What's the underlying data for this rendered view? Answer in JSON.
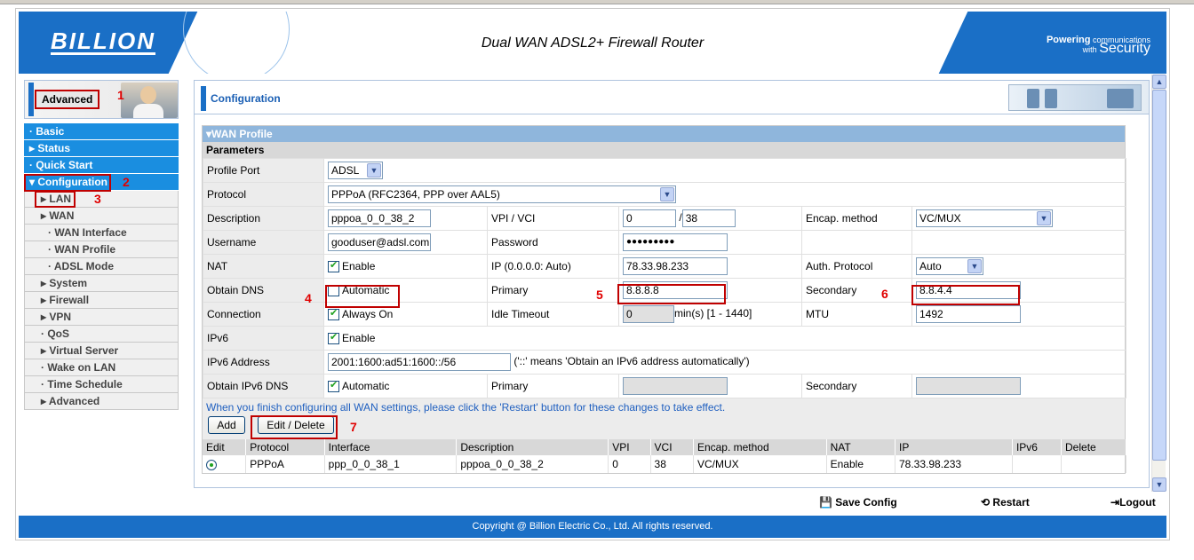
{
  "header": {
    "logo": "BILLION",
    "title": "Dual WAN ADSL2+ Firewall Router",
    "tag_line1": "Powering",
    "tag_line2": "communications",
    "tag_line3": "with",
    "tag_line4": "Security"
  },
  "sidebar": {
    "advanced_btn": "Advanced",
    "items": [
      {
        "label": "· Basic",
        "level": "top"
      },
      {
        "label": "▸ Status",
        "level": "top"
      },
      {
        "label": "· Quick Start",
        "level": "top"
      },
      {
        "label": "▾ Configuration",
        "level": "top"
      },
      {
        "label": "▸ LAN",
        "level": "sub"
      },
      {
        "label": "▸ WAN",
        "level": "sub"
      },
      {
        "label": "· WAN Interface",
        "level": "subsub"
      },
      {
        "label": "· WAN Profile",
        "level": "subsub"
      },
      {
        "label": "· ADSL Mode",
        "level": "subsub"
      },
      {
        "label": "▸ System",
        "level": "sub"
      },
      {
        "label": "▸ Firewall",
        "level": "sub"
      },
      {
        "label": "▸ VPN",
        "level": "sub"
      },
      {
        "label": "· QoS",
        "level": "sub"
      },
      {
        "label": "▸ Virtual Server",
        "level": "sub"
      },
      {
        "label": "· Wake on LAN",
        "level": "sub"
      },
      {
        "label": "· Time Schedule",
        "level": "sub"
      },
      {
        "label": "▸ Advanced",
        "level": "sub"
      }
    ]
  },
  "annotations": [
    "1",
    "2",
    "3",
    "4",
    "5",
    "6",
    "7"
  ],
  "main": {
    "title": "Configuration",
    "panel_title": "▾WAN Profile",
    "params_title": "Parameters",
    "labels": {
      "profile_port": "Profile Port",
      "protocol": "Protocol",
      "description": "Description",
      "vpi_vci": "VPI / VCI",
      "encap": "Encap. method",
      "username": "Username",
      "password": "Password",
      "nat": "NAT",
      "ip": "IP (0.0.0.0: Auto)",
      "auth": "Auth. Protocol",
      "obtain_dns": "Obtain DNS",
      "primary": "Primary",
      "secondary": "Secondary",
      "connection": "Connection",
      "idle": "Idle Timeout",
      "mtu": "MTU",
      "ipv6": "IPv6",
      "ipv6_addr": "IPv6 Address",
      "obtain_ipv6_dns": "Obtain IPv6 DNS",
      "primary2": "Primary",
      "secondary2": "Secondary"
    },
    "values": {
      "profile_port": "ADSL",
      "protocol": "PPPoA (RFC2364, PPP over AAL5)",
      "description": "pppoa_0_0_38_2",
      "vpi": "0",
      "slash": "/",
      "vci": "38",
      "encap": "VC/MUX",
      "username": "gooduser@adsl.com",
      "password": "●●●●●●●●●",
      "nat_chk": "Enable",
      "ip": "78.33.98.233",
      "auth": "Auto",
      "dns_chk": "Automatic",
      "primary": "8.8.8.8",
      "secondary": "8.8.4.4",
      "conn_chk": "Always On",
      "idle": "0",
      "idle_unit": "min(s) [1 - 1440]",
      "mtu": "1492",
      "ipv6_chk": "Enable",
      "ipv6_addr": "2001:1600:ad51:1600::/56",
      "ipv6_note": "('::' means 'Obtain an IPv6 address automatically')",
      "ipv6_dns_chk": "Automatic"
    },
    "note": "When you finish configuring all WAN settings, please click the 'Restart' button for these changes to take effect.",
    "add_btn": "Add",
    "edit_btn": "Edit / Delete",
    "list": {
      "headers": [
        "Edit",
        "Protocol",
        "Interface",
        "Description",
        "VPI",
        "VCI",
        "Encap. method",
        "NAT",
        "IP",
        "IPv6",
        "Delete"
      ],
      "row": [
        "",
        "PPPoA",
        "ppp_0_0_38_1",
        "pppoa_0_0_38_2",
        "0",
        "38",
        "VC/MUX",
        "Enable",
        "78.33.98.233",
        "",
        ""
      ]
    }
  },
  "actions": {
    "save": "Save Config",
    "restart": "Restart",
    "logout": "Logout"
  },
  "footer": "Copyright @ Billion Electric Co., Ltd. All rights reserved."
}
